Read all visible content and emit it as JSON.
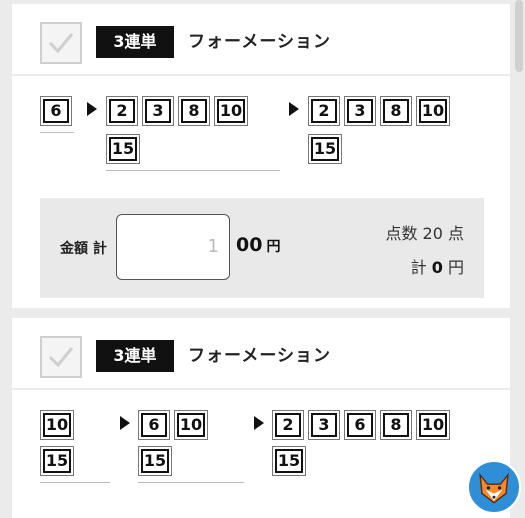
{
  "ticket1": {
    "bet_type": "3連単",
    "mode": "フォーメーション",
    "first": [
      "6"
    ],
    "second": [
      "2",
      "3",
      "8",
      "10",
      "15"
    ],
    "third": [
      "2",
      "3",
      "8",
      "10",
      "15"
    ],
    "amount_label": "金額 計",
    "amount_value": "1",
    "amount_suffix": "00",
    "yen": "円",
    "points_text": "点数 20 点",
    "total_prefix": "計",
    "total_value": "0",
    "total_suffix": "円"
  },
  "ticket2": {
    "bet_type": "3連単",
    "mode": "フォーメーション",
    "first": [
      "10",
      "15"
    ],
    "second": [
      "6",
      "10",
      "15"
    ],
    "third": [
      "2",
      "3",
      "6",
      "8",
      "10",
      "15"
    ]
  },
  "icons": {
    "checkbox": "check-icon",
    "arrow": "play-arrow-icon",
    "mascot": "fox-mascot-icon"
  },
  "colors": {
    "badge": "#111111",
    "panel": "#e9e9e9",
    "page_bg": "#ebebeb"
  }
}
